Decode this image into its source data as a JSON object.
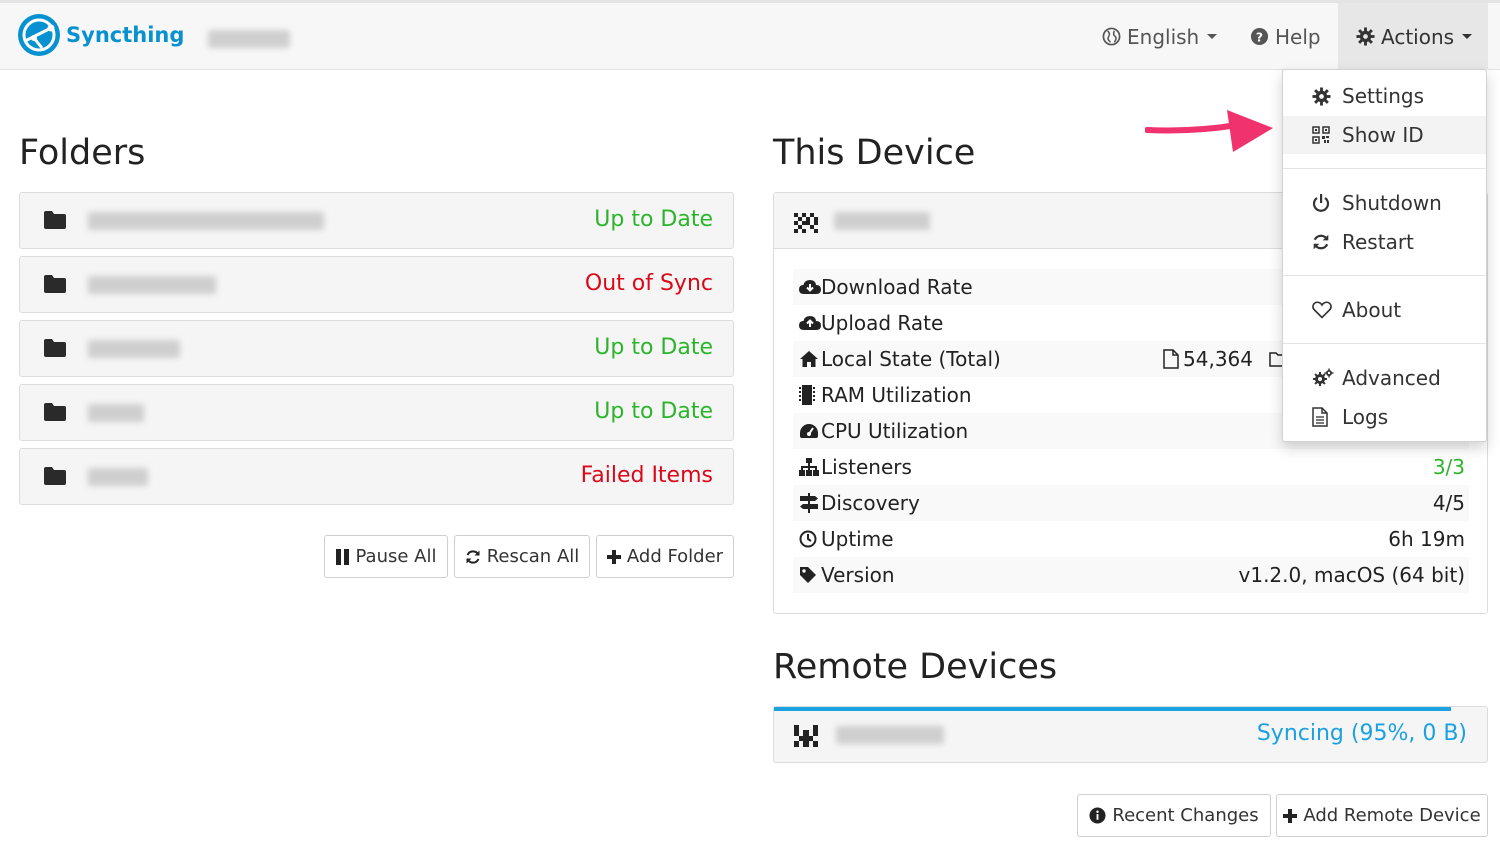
{
  "app": {
    "name": "Syncthing",
    "accent": "#0891d1"
  },
  "nav": {
    "language": "English",
    "help": "Help",
    "actions": "Actions"
  },
  "actions_menu": {
    "settings": "Settings",
    "show_id": "Show ID",
    "shutdown": "Shutdown",
    "restart": "Restart",
    "about": "About",
    "advanced": "Advanced",
    "logs": "Logs"
  },
  "folders": {
    "title": "Folders",
    "items": [
      {
        "status": "Up to Date",
        "status_color": "#2cb52c",
        "icon": "folder-icon"
      },
      {
        "status": "Out of Sync",
        "status_color": "#d9091a",
        "icon": "folder-icon"
      },
      {
        "status": "Up to Date",
        "status_color": "#2cb52c",
        "icon": "folder-icon"
      },
      {
        "status": "Up to Date",
        "status_color": "#2cb52c",
        "icon": "folder-icon"
      },
      {
        "status": "Failed Items",
        "status_color": "#d9091a",
        "icon": "folder-icon"
      }
    ],
    "buttons": {
      "pause_all": "Pause All",
      "rescan_all": "Rescan All",
      "add_folder": "Add Folder"
    }
  },
  "this_device": {
    "title": "This Device",
    "stats": [
      {
        "label": "Download Rate",
        "value": "",
        "icon": "cloud-download-icon"
      },
      {
        "label": "Upload Rate",
        "value": "",
        "icon": "cloud-upload-icon"
      },
      {
        "label": "Local State (Total)",
        "value": "54,364",
        "icon": "home-icon"
      },
      {
        "label": "RAM Utilization",
        "value": "",
        "icon": "memory-icon"
      },
      {
        "label": "CPU Utilization",
        "value": "",
        "icon": "dashboard-icon"
      },
      {
        "label": "Listeners",
        "value": "3/3",
        "value_color": "#2cb52c",
        "icon": "sitemap-icon"
      },
      {
        "label": "Discovery",
        "value": "4/5",
        "icon": "signpost-icon"
      },
      {
        "label": "Uptime",
        "value": "6h 19m",
        "icon": "clock-icon"
      },
      {
        "label": "Version",
        "value": "v1.2.0, macOS (64 bit)",
        "icon": "tag-icon"
      }
    ]
  },
  "remote_devices": {
    "title": "Remote Devices",
    "items": [
      {
        "status": "Syncing (95%, 0 B)",
        "progress": 0.95,
        "status_color": "#1ba1e2"
      }
    ],
    "buttons": {
      "recent_changes": "Recent Changes",
      "add_remote_device": "Add Remote Device"
    }
  },
  "annotation": {
    "arrow_color": "#f0336f"
  }
}
